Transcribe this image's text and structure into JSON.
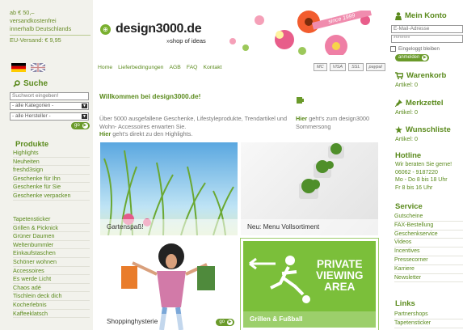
{
  "shipping": {
    "line1": "ab € 50,–",
    "line2": "versandkostenfrei",
    "line3": "innerhalb Deutschlands",
    "line4": "EU-Versand: € 9,95"
  },
  "banner": {
    "logo": "design3000.de",
    "tagline": "»shop of ideas",
    "since": "since 1999"
  },
  "topnav": [
    "Home",
    "Lieferbedingungen",
    "AGB",
    "FAQ",
    "Kontakt"
  ],
  "payment": [
    "MC",
    "VISA",
    "SSL",
    "paypal"
  ],
  "search": {
    "title": "Suche",
    "placeholder": "Suchwort eingeben!",
    "category": "- alle Kategorien -",
    "vendor": "- alle Hersteller -",
    "go": "go"
  },
  "products": {
    "title": "Produkte",
    "group1": [
      "Highlights",
      "Neuheiten",
      "freshd3sign",
      "Geschenke für Ihn",
      "Geschenke für Sie",
      "Geschenke verpacken"
    ],
    "group2": [
      "Tapetensticker",
      "Grillen & Picknick",
      "Grüner Daumen",
      "Weltenbummler",
      "Einkaufstaschen",
      "Schöner wohnen",
      "Accessoires",
      "Es werde Licht",
      "Chaos adé",
      "Tischlein deck dich",
      "Kocherlebnis",
      "Kaffeeklatsch"
    ]
  },
  "welcome": {
    "title": "Willkommen bei design3000.de!",
    "text": "Über 5000 ausgefallene Geschenke, Lifestyleprodukte, Trendartikel und Wohn- Accessoires erwarten Sie.",
    "hier": "Hier",
    "rest": " geht's direkt zu den Highlights."
  },
  "summer": {
    "hier": "Hier",
    "rest": " geht's zum design3000 Sommersong"
  },
  "tiles": {
    "t1": "Gartenspaß!",
    "t2": "Neu: Menu Vollsortiment",
    "t3": "Shoppinghysterie",
    "t3_go": "go",
    "t4": "Grillen & Fußball",
    "pv1": "PRIVATE",
    "pv2": "VIEWING",
    "pv3": "AREA"
  },
  "account": {
    "title": "Mein Konto",
    "email_placeholder": "E-Mail-Adresse",
    "password": "********",
    "remember": "Eingeloggt bleiben",
    "login": "anmelden"
  },
  "cart": {
    "title": "Warenkorb",
    "count": "Artikel: 0"
  },
  "watch": {
    "title": "Merkzettel",
    "count": "Artikel: 0"
  },
  "wish": {
    "title": "Wunschliste",
    "count": "Artikel: 0"
  },
  "hotline": {
    "title": "Hotline",
    "lines": [
      "Wir beraten Sie gerne!",
      "06062 - 9187220",
      "Mo - Do 8 bis 18 Uhr",
      "Fr 8 bis 16 Uhr"
    ]
  },
  "service": {
    "title": "Service",
    "items": [
      "Gutscheine",
      "FAX-Bestellung",
      "Geschenkservice",
      "Videos",
      "Incentives",
      "Pressecorner",
      "Karriere",
      "Newsletter"
    ]
  },
  "links": {
    "title": "Links",
    "items": [
      "Partnershops",
      "Tapetensticker"
    ]
  }
}
